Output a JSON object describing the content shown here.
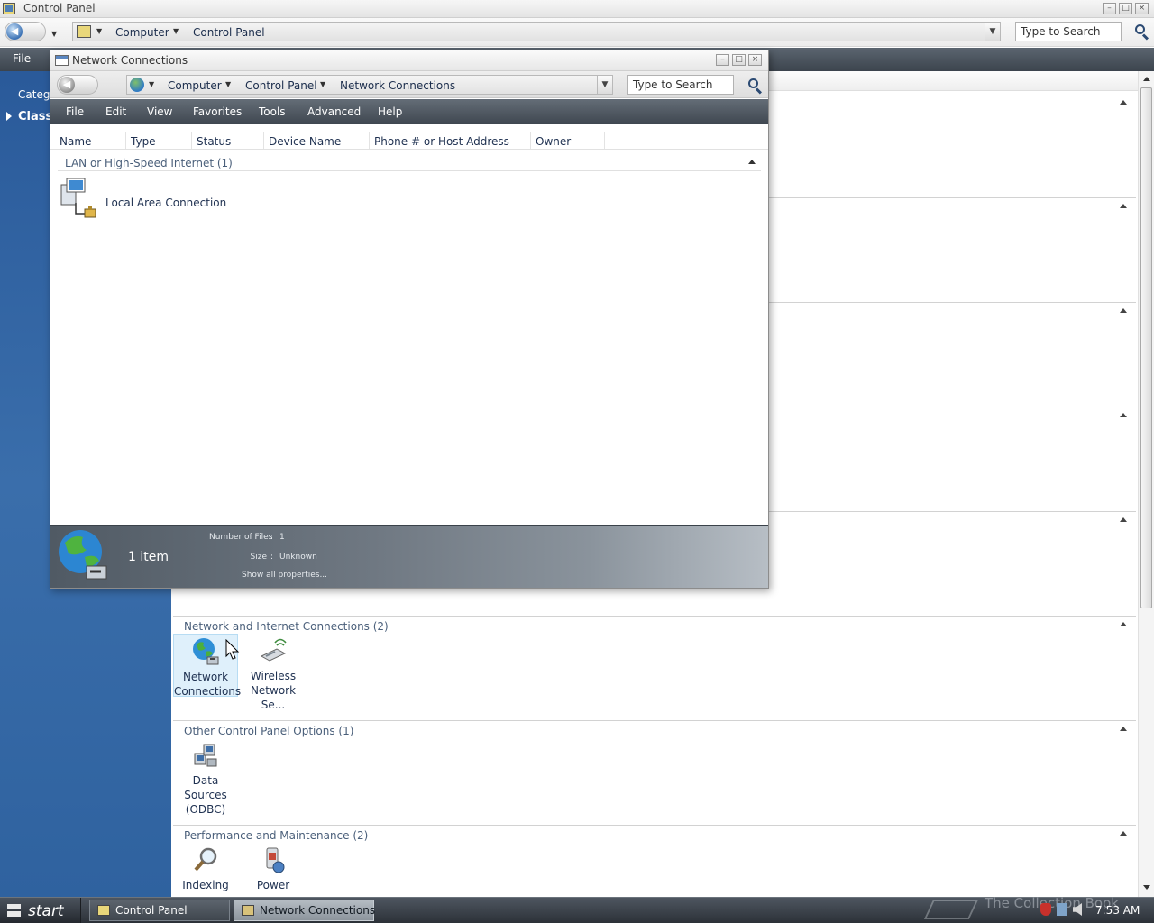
{
  "cp_window": {
    "title": "Control Panel",
    "address": {
      "crumbs": [
        "Computer",
        "Control Panel"
      ]
    },
    "search_placeholder": "Type to Search",
    "menu": {
      "file": "File"
    },
    "sidebar": {
      "category_link": "Categ",
      "classic_link": "Class"
    },
    "groups": [
      {
        "title": "Network and Internet Connections (2)",
        "items": [
          {
            "label_line1": "Network",
            "label_line2": "Connections",
            "icon": "network-globe-icon",
            "selected": true
          },
          {
            "label_line1": "Wireless",
            "label_line2": "Network Se...",
            "icon": "wireless-adapter-icon"
          }
        ]
      },
      {
        "title": "Other Control Panel Options (1)",
        "items": [
          {
            "label_line1": "Data Sources",
            "label_line2": "(ODBC)",
            "icon": "data-sources-icon"
          }
        ]
      },
      {
        "title": "Performance and Maintenance (2)",
        "items": [
          {
            "label_line1": "Indexing",
            "label_line2": "",
            "icon": "magnifier-icon"
          },
          {
            "label_line1": "Power",
            "label_line2": "",
            "icon": "power-icon"
          }
        ]
      }
    ]
  },
  "nc_window": {
    "title": "Network Connections",
    "address": {
      "crumbs": [
        "Computer",
        "Control Panel",
        "Network Connections"
      ]
    },
    "search_placeholder": "Type to Search",
    "menu": [
      "File",
      "Edit",
      "View",
      "Favorites",
      "Tools",
      "Advanced",
      "Help"
    ],
    "columns": [
      "Name",
      "Type",
      "Status",
      "Device Name",
      "Phone # or Host Address",
      "Owner"
    ],
    "group": {
      "title": "LAN or High-Speed Internet (1)"
    },
    "items": [
      {
        "label": "Local Area Connection",
        "icon": "lan-connection-icon"
      }
    ],
    "details": {
      "count": "1 item",
      "files_label": "Number of Files",
      "files_value": "1",
      "size_label": "Size",
      "size_value": "Unknown",
      "show_all": "Show all properties..."
    }
  },
  "taskbar": {
    "start": "start",
    "buttons": [
      {
        "label": "Control Panel",
        "active": false
      },
      {
        "label": "Network Connections",
        "active": true
      }
    ],
    "watermark": "The Collection Book",
    "clock": "7:53 AM"
  },
  "colors": {
    "sidebar_blue": "#3a6eab",
    "menubar_dark": "#3f4750",
    "selection": "#dff0fb"
  }
}
